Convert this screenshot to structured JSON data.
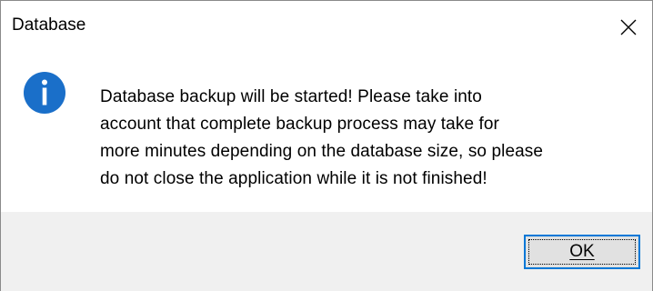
{
  "window": {
    "title": "Database",
    "close_icon": "close-icon"
  },
  "message": {
    "icon": "info-icon",
    "lines": [
      "Database backup will be started! Please take into",
      "account that complete backup process may take for",
      "more minutes depending on the database size, so please",
      "do not close the application while it is not finished!"
    ]
  },
  "buttons": {
    "ok_label": "OK"
  },
  "colors": {
    "info_icon": "#1a6fc9",
    "footer_bg": "#f0f0f0",
    "focus_border": "#0078d7",
    "button_bg": "#e1e1e1"
  }
}
